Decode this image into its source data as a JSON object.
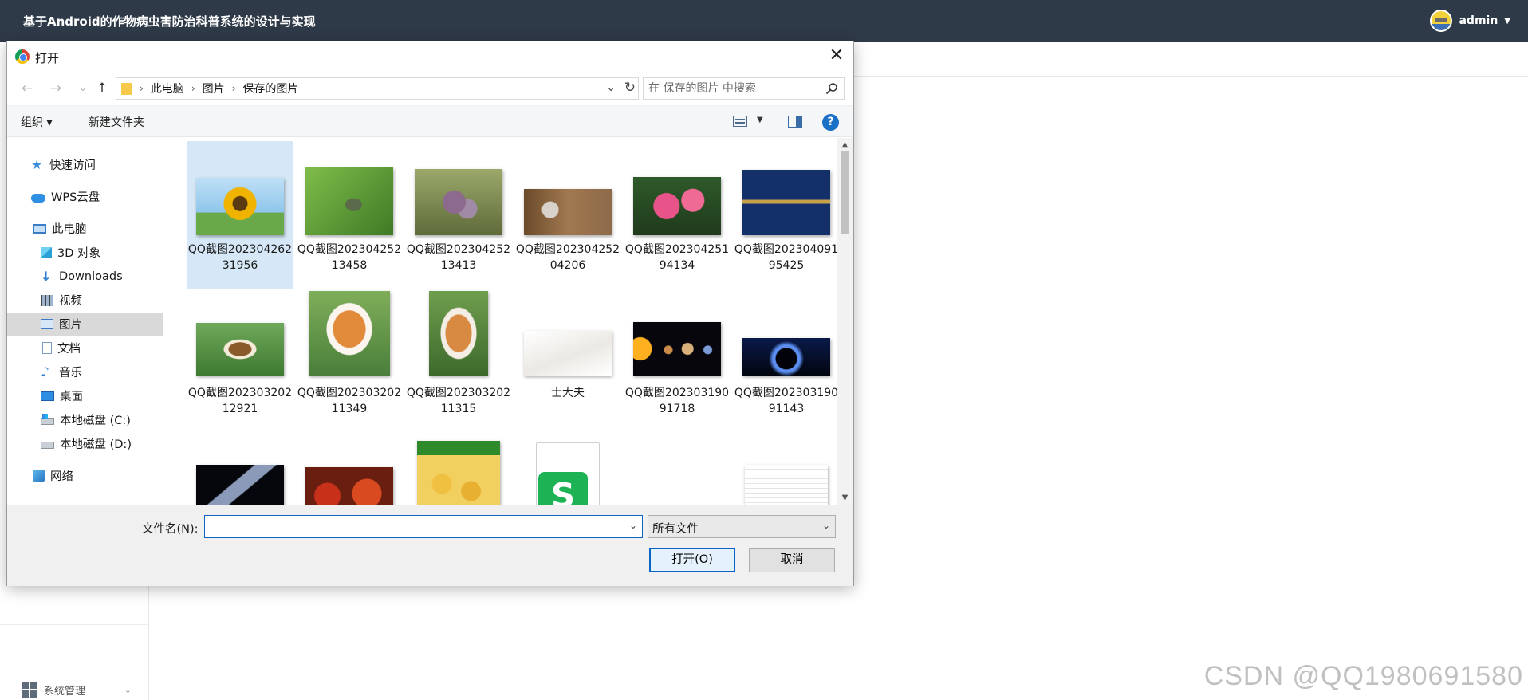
{
  "app": {
    "title": "基于Android的作物病虫害防治科普系统的设计与实现",
    "user": "admin",
    "sidebar_menu": "系统管理",
    "watermark": "CSDN @QQ1980691580"
  },
  "dialog": {
    "title": "打开",
    "close_glyph": "✕",
    "nav": {
      "back": "←",
      "forward": "→",
      "recent": "⌄",
      "up": "↑"
    },
    "breadcrumbs": [
      "此电脑",
      "图片",
      "保存的图片"
    ],
    "search_placeholder": "在 保存的图片 中搜索",
    "toolbar": {
      "organize": "组织 ▾",
      "new_folder": "新建文件夹",
      "help": "?"
    },
    "tree": [
      {
        "label": "快速访问",
        "icon": "star-icon"
      },
      {
        "label": "WPS云盘",
        "icon": "cloud-icon"
      },
      {
        "label": "此电脑",
        "icon": "computer-icon"
      },
      {
        "label": "3D 对象",
        "icon": "3d-objects-icon"
      },
      {
        "label": "Downloads",
        "icon": "download-icon"
      },
      {
        "label": "视频",
        "icon": "video-icon"
      },
      {
        "label": "图片",
        "icon": "pictures-icon"
      },
      {
        "label": "文档",
        "icon": "document-icon"
      },
      {
        "label": "音乐",
        "icon": "music-icon"
      },
      {
        "label": "桌面",
        "icon": "desktop-icon"
      },
      {
        "label": "本地磁盘 (C:)",
        "icon": "disk-c-icon"
      },
      {
        "label": "本地磁盘 (D:)",
        "icon": "disk-icon"
      },
      {
        "label": "网络",
        "icon": "network-icon"
      }
    ],
    "files": [
      {
        "name": "QQ截图20230426231956",
        "thumb": "sunflower-thumbnail"
      },
      {
        "name": "QQ截图20230425213458",
        "thumb": "insect-on-leaf-thumbnail"
      },
      {
        "name": "QQ截图20230425213413",
        "thumb": "grapes-thumbnail"
      },
      {
        "name": "QQ截图20230425204206",
        "thumb": "person-photo-thumbnail"
      },
      {
        "name": "QQ截图20230425194134",
        "thumb": "pink-flowers-thumbnail"
      },
      {
        "name": "QQ截图20230409195425",
        "thumb": "vip-cards-thumbnail"
      },
      {
        "name": "QQ截图20230320212921",
        "thumb": "beagle-puppy-thumbnail"
      },
      {
        "name": "QQ截图20230320211349",
        "thumb": "corgi-thumbnail"
      },
      {
        "name": "QQ截图20230320211315",
        "thumb": "corgi-2-thumbnail"
      },
      {
        "name": "士大夫",
        "thumb": "white-fabric-thumbnail"
      },
      {
        "name": "QQ截图20230319091718",
        "thumb": "solar-system-thumbnail"
      },
      {
        "name": "QQ截图20230319091143",
        "thumb": "planet-eclipse-thumbnail"
      },
      {
        "name": "",
        "thumb": "satellite-thumbnail"
      },
      {
        "name": "",
        "thumb": "apples-thumbnail"
      },
      {
        "name": "",
        "thumb": "fruit-poster-thumbnail"
      },
      {
        "name": "",
        "thumb": "wps-file-icon"
      },
      {
        "name": "",
        "thumb": "document-thumbnail"
      }
    ],
    "filename_label": "文件名(N):",
    "filename_value": "",
    "filetype": "所有文件",
    "open_button": "打开(O)",
    "cancel_button": "取消"
  }
}
